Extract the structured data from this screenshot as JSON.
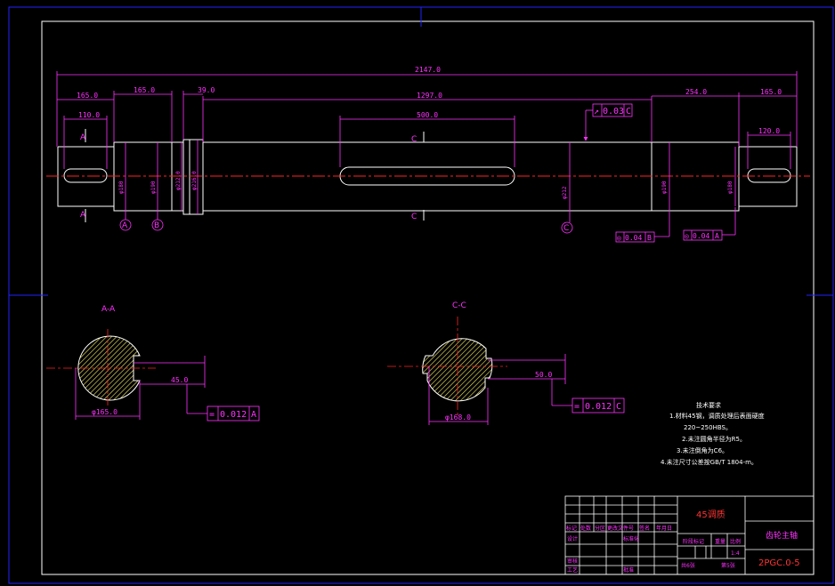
{
  "colors": {
    "background": "#000000",
    "outline": "#ffffff",
    "dimension": "#ff33ff",
    "centerline": "#ff2222",
    "frame": "#2222ff",
    "hatch": "#e8e060"
  },
  "dimensions": {
    "overall": "2147.0",
    "left_end": "165.0",
    "left_journal": "165.0",
    "collar": "39.0",
    "middle": "1297.0",
    "right_journal": "254.0",
    "right_end": "165.0",
    "keyway_left": "110.0",
    "keyway_mid": "500.0",
    "keyway_right": "120.0",
    "d1": "φ180",
    "d2": "φ190",
    "d3": "φ212.0",
    "d4": "φ216.0",
    "d5": "φ212",
    "d6": "φ190",
    "d7": "φ180"
  },
  "datums": {
    "a": "A",
    "b": "B",
    "c": "C"
  },
  "tolerances": {
    "top": {
      "symbol": "↗",
      "value": "0.03",
      "datum": "C"
    },
    "bottom_mid": {
      "symbol": "◎",
      "value": "0.04",
      "datum": "B"
    },
    "bottom_right": {
      "symbol": "◎",
      "value": "0.04",
      "datum": "A"
    },
    "section_a": {
      "symbol": "=",
      "value": "0.012",
      "datum": "A"
    },
    "section_c": {
      "symbol": "=",
      "value": "0.012",
      "datum": "C"
    }
  },
  "sections": {
    "a": {
      "title": "A-A",
      "marker": "A",
      "diameter": "φ165.0",
      "depth": "45.0"
    },
    "c": {
      "title": "C-C",
      "marker": "C",
      "diameter": "φ168.0",
      "depth": "50.0"
    }
  },
  "notes": {
    "heading": "技术要求",
    "lines": [
      "1.材料45钢，调质处理后表面硬度",
      "220~250HBS。",
      "2.未注圆角半径为R5。",
      "3.未注倒角为C6。",
      "4.未注尺寸公差按GB/T 1804-m。"
    ]
  },
  "title_block": {
    "material": "45调质",
    "part_name": "齿轮主轴",
    "drawing_no": "2PGC.0-5",
    "headers": [
      "标记",
      "处数",
      "分区",
      "更改文件号",
      "签名",
      "年月日"
    ],
    "roles": [
      "设计",
      "审核",
      "工艺"
    ],
    "standardize": "标准化",
    "approve": "批准",
    "stage_mark": "阶段标记",
    "weight": "重量",
    "scale": "比例",
    "scale_value": "1:4",
    "sheets_total": "共6张",
    "sheet_no": "第5张"
  }
}
